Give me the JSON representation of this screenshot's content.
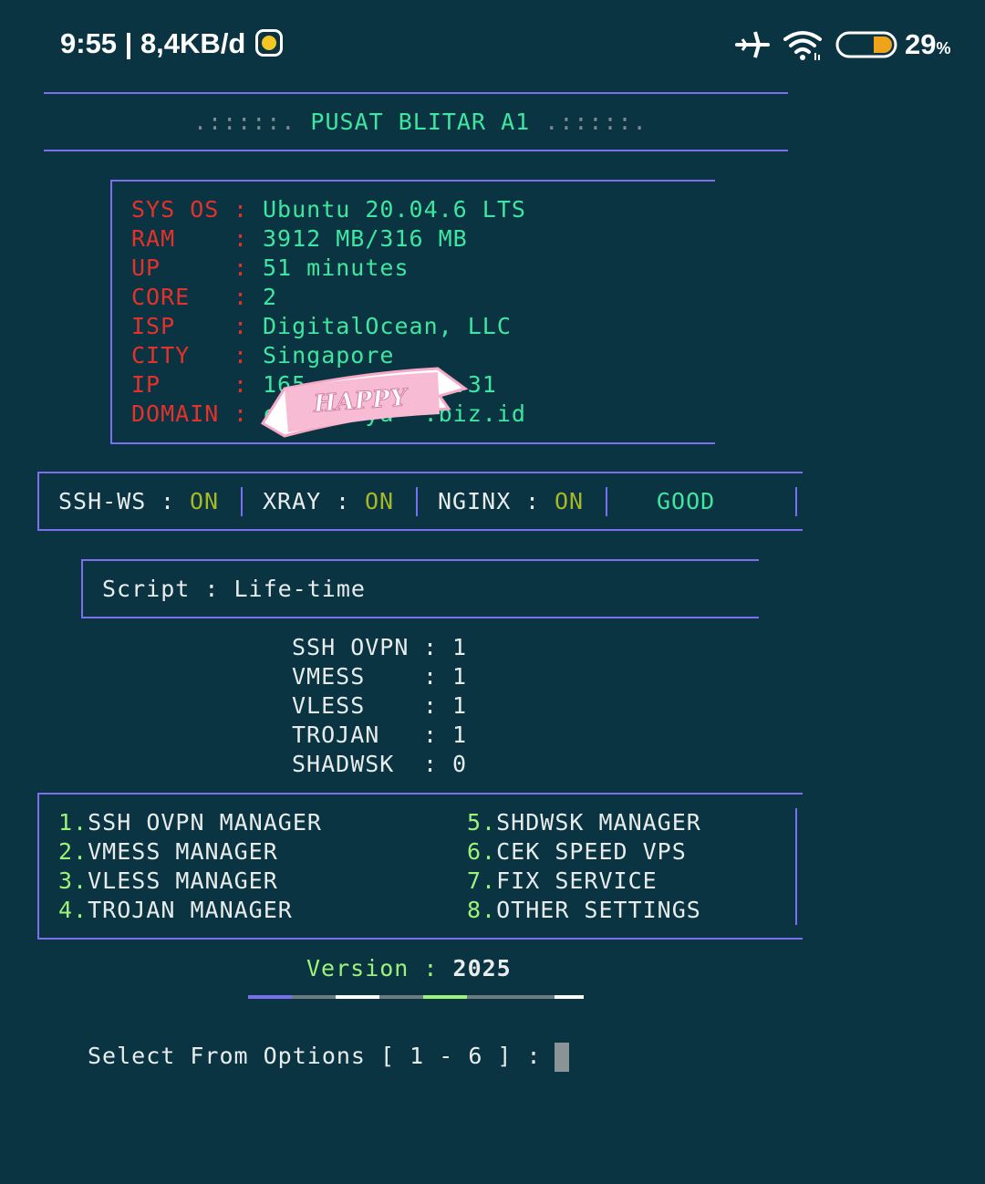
{
  "status_bar": {
    "time": "9:55 | 8,4KB/d",
    "battery": "29",
    "battery_unit": "%",
    "icons": [
      "emoji-icon",
      "airplane-icon",
      "wifi-icon",
      "battery-icon"
    ]
  },
  "header": {
    "left_dots": ".:::::.",
    "title": "PUSAT BLITAR A1",
    "right_dots": ".:::::."
  },
  "sysinfo": {
    "rows": [
      {
        "label": "SYS OS",
        "value": "Ubuntu 20.04.6 LTS"
      },
      {
        "label": "RAM",
        "value": "3912 MB/316 MB"
      },
      {
        "label": "UP",
        "value": "51 minutes"
      },
      {
        "label": "CORE",
        "value": "2"
      },
      {
        "label": "ISP",
        "value": "DigitalOcean, LLC"
      },
      {
        "label": "CITY",
        "value": "Singapore"
      },
      {
        "label": "IP",
        "value": "165.  .168.  .31"
      },
      {
        "label": "DOMAIN",
        "value": "c.   arya  .biz.id"
      }
    ],
    "sticker_text": "HAPPY"
  },
  "services": {
    "ssh_label": "SSH-WS",
    "ssh_state": "ON",
    "xray_label": "XRAY",
    "xray_state": "ON",
    "nginx_label": "NGINX",
    "nginx_state": "ON",
    "overall": "GOOD"
  },
  "script": {
    "label": "Script",
    "value": "Life-time"
  },
  "accounts": [
    {
      "name": "SSH OVPN",
      "count": "1"
    },
    {
      "name": "VMESS",
      "count": "1"
    },
    {
      "name": "VLESS",
      "count": "1"
    },
    {
      "name": "TROJAN",
      "count": "1"
    },
    {
      "name": "SHADWSK",
      "count": "0"
    }
  ],
  "menu": {
    "left": [
      {
        "num": "1.",
        "label": "SSH OVPN MANAGER"
      },
      {
        "num": "2.",
        "label": "VMESS MANAGER"
      },
      {
        "num": "3.",
        "label": "VLESS MANAGER"
      },
      {
        "num": "4.",
        "label": "TROJAN MANAGER"
      }
    ],
    "right": [
      {
        "num": "5.",
        "label": "SHDWSK MANAGER"
      },
      {
        "num": "6.",
        "label": "CEK SPEED VPS"
      },
      {
        "num": "7.",
        "label": "FIX SERVICE"
      },
      {
        "num": "8.",
        "label": "OTHER SETTINGS"
      }
    ]
  },
  "version": {
    "label": "Version",
    "value": "2025"
  },
  "prompt": {
    "text": "Select From Options [ 1 - 6 ] :"
  },
  "colors": {
    "background": "#0a3442",
    "border": "#7b6ff0",
    "label_red": "#e5312b",
    "value_green": "#3ee6a0",
    "status_on": "#a8b824",
    "menu_number": "#9cf37a"
  }
}
